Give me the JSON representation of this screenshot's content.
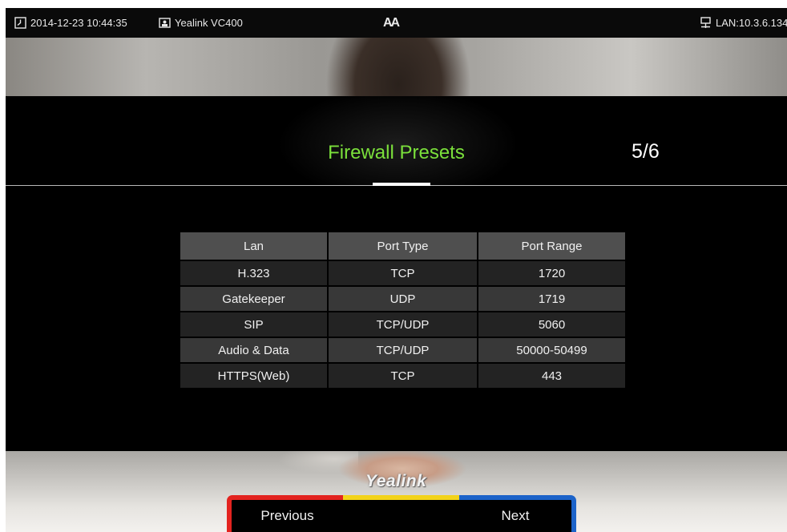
{
  "status_bar": {
    "datetime": "2014-12-23 10:44:35",
    "device": "Yealink VC400",
    "font_toggle": "AA",
    "lan": "LAN:10.3.6.134"
  },
  "title": {
    "text": "Firewall Presets",
    "page_indicator": "5/6"
  },
  "table": {
    "headers": [
      "Lan",
      "Port Type",
      "Port Range"
    ],
    "rows": [
      [
        "H.323",
        "TCP",
        "1720"
      ],
      [
        "Gatekeeper",
        "UDP",
        "1719"
      ],
      [
        "SIP",
        "TCP/UDP",
        "5060"
      ],
      [
        "Audio & Data",
        "TCP/UDP",
        "50000-50499"
      ],
      [
        "HTTPS(Web)",
        "TCP",
        "443"
      ]
    ]
  },
  "brand": "Yealink",
  "softkeys": {
    "red": "Previous",
    "yellow": "",
    "blue": "Next"
  },
  "colors": {
    "title_green": "#7be03b",
    "softkey_red": "#e3231f",
    "softkey_yellow": "#f3d31a",
    "softkey_blue": "#1c63c9"
  },
  "icons": {
    "datetime": "clock-icon",
    "device": "video-device-icon",
    "lan": "network-icon"
  }
}
